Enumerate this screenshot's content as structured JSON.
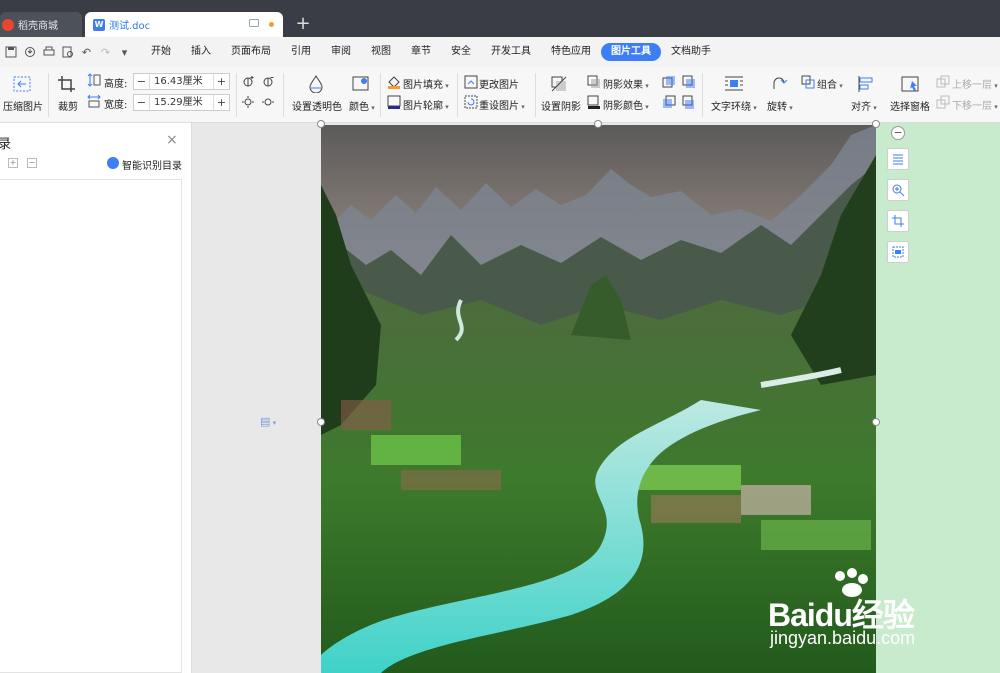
{
  "tabs": [
    {
      "label": "稻壳商城"
    },
    {
      "label": "测试.doc"
    }
  ],
  "tab_add": "+",
  "menu": [
    "开始",
    "插入",
    "页面布局",
    "引用",
    "审阅",
    "视图",
    "章节",
    "安全",
    "开发工具",
    "特色应用",
    "图片工具",
    "文档助手"
  ],
  "ribbon": {
    "compress": "压缩图片",
    "crop": "裁剪",
    "height_label": "高度:",
    "height_value": "16.43厘米",
    "width_label": "宽度:",
    "width_value": "15.29厘米",
    "transparent": "设置透明色",
    "color": "颜色",
    "fill": "图片填充",
    "outline": "图片轮廓",
    "change_pic": "更改图片",
    "reset_pic": "重设图片",
    "shadow": "设置阴影",
    "shadow_effect": "阴影效果",
    "shadow_color": "阴影颜色",
    "wrap": "文字环绕",
    "rotate": "旋转",
    "group": "组合",
    "align": "对齐",
    "select_pane": "选择窗格",
    "bring_forward": "上移一层",
    "send_backward": "下移一层",
    "minus": "−",
    "plus": "+"
  },
  "left_panel": {
    "title_fragment": "录",
    "smart_toc": "智能识别目录"
  },
  "watermark": {
    "brand": "Baidu经验",
    "url": "jingyan.baidu.com"
  },
  "colors": {
    "accent": "#3d7ef6",
    "green_pane": "#c9ebcd"
  }
}
